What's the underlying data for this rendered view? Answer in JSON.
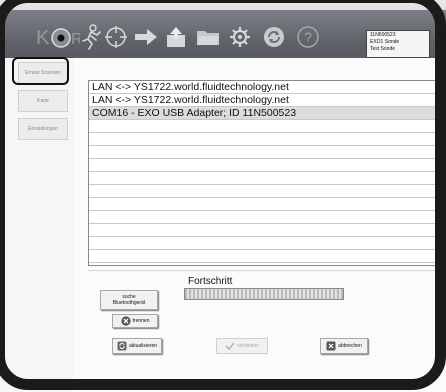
{
  "device_info": [
    "11N500523",
    "EXO1 Sonde",
    "Test Sonde"
  ],
  "sidebar": {
    "items": [
      {
        "label": "Erneut Scannen"
      },
      {
        "label": "Karte"
      },
      {
        "label": "Einstellungen"
      }
    ]
  },
  "connections": [
    "LAN <-> YS1722.world.fluidtechnology.net",
    "LAN <-> YS1722.world.fluidtechnology.net",
    "COM16 - EXO USB Adapter; ID 11N500523"
  ],
  "progress": {
    "label": "Fortschritt"
  },
  "buttons": {
    "search_bluetooth": "suche Bluetoothgerät",
    "disconnect": "trennen",
    "refresh": "aktualisieren",
    "connect": "verbinden",
    "cancel": "abbrechen"
  },
  "colors": {
    "toolbar": "#5e6167",
    "selected_row": "#dcdcdc",
    "cancel_icon": "#555555"
  }
}
